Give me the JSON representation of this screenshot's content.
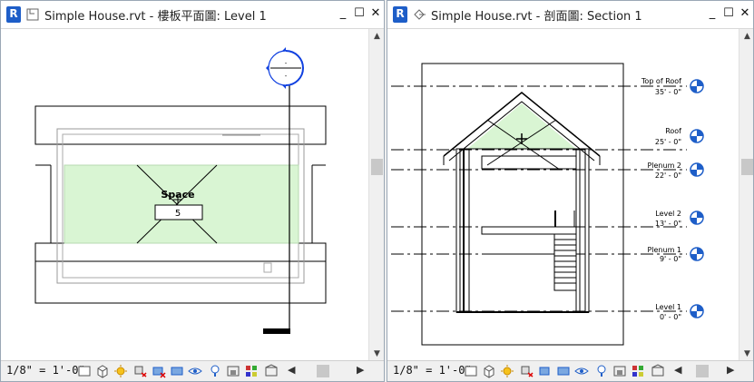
{
  "app": {
    "logo_letter": "R"
  },
  "left_window": {
    "title": "Simple House.rvt - 樓板平面圖: Level 1",
    "buttons": {
      "minimize": "_",
      "maximize": "☐",
      "close": "✕"
    },
    "space_label": "Space",
    "space_number": "5",
    "scale": "1/8\" = 1'-0\"",
    "scroll_up": "▲",
    "scroll_down": "▼",
    "scroll_left": "◀",
    "scroll_right": "▶"
  },
  "right_window": {
    "title": "Simple House.rvt - 剖面圖: Section 1",
    "buttons": {
      "minimize": "_",
      "maximize": "☐",
      "close": "✕"
    },
    "levels": [
      {
        "name": "Top of Roof",
        "elev": "35' - 0\""
      },
      {
        "name": "Roof",
        "elev": "25' - 0\""
      },
      {
        "name": "Plenum 2",
        "elev": "22' - 0\""
      },
      {
        "name": "Level 2",
        "elev": "13' - 0\""
      },
      {
        "name": "Plenum 1",
        "elev": "9' - 0\""
      },
      {
        "name": "Level 1",
        "elev": "0' - 0\""
      }
    ],
    "scale": "1/8\" = 1'-0\"",
    "scroll_up": "▲",
    "scroll_down": "▼",
    "scroll_left": "◀",
    "scroll_right": "▶"
  },
  "colors": {
    "space_fill": "#d9f5d3",
    "accent_blue": "#1e5ec8",
    "section_blue": "#1040e0"
  },
  "status_icons": [
    "thin-lines-icon",
    "3d-box-icon",
    "sun-path-icon",
    "shadows-icon",
    "crop-region-icon",
    "show-crop-icon",
    "temporary-hide-icon",
    "reveal-hidden-icon",
    "lock-3d-icon",
    "worksharing-icon",
    "analytical-model-icon",
    "highlight-displacement-icon"
  ]
}
